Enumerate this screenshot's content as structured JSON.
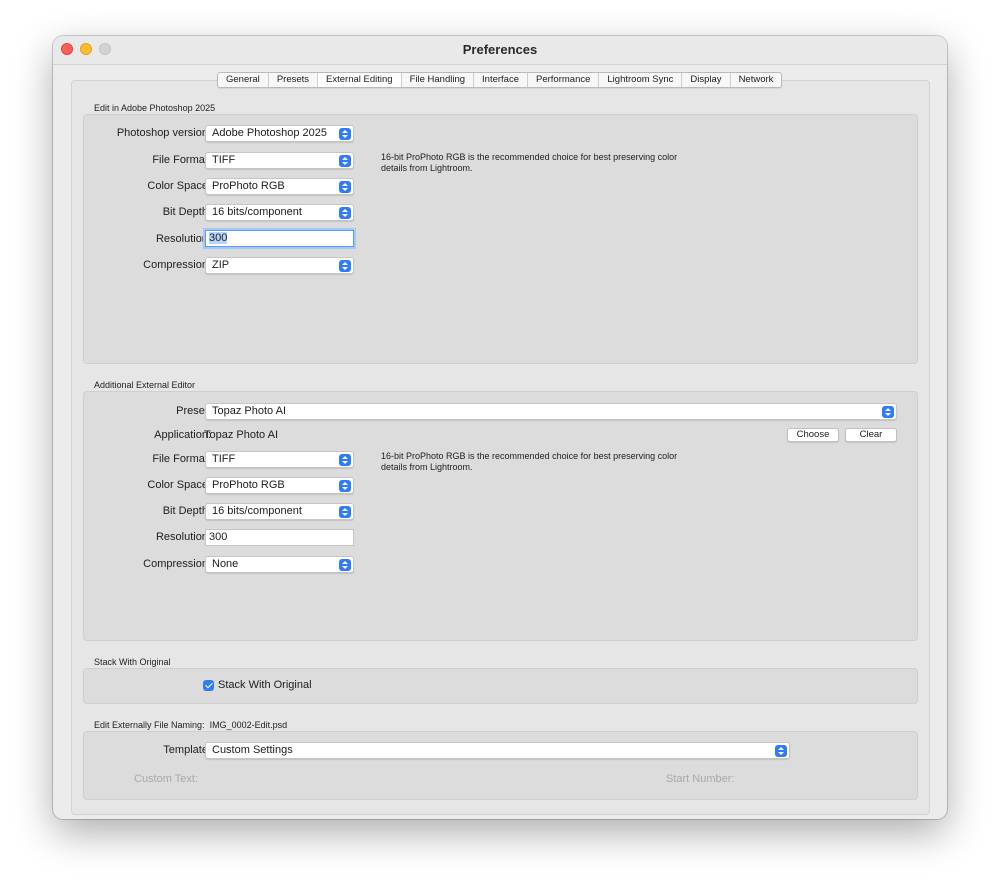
{
  "window": {
    "title": "Preferences"
  },
  "tabs": [
    "General",
    "Presets",
    "External Editing",
    "File Handling",
    "Interface",
    "Performance",
    "Lightroom Sync",
    "Display",
    "Network"
  ],
  "active_tab": "External Editing",
  "photoshop": {
    "section_title": "Edit in Adobe Photoshop 2025",
    "labels": {
      "version": "Photoshop version:",
      "file_format": "File Format:",
      "color_space": "Color Space:",
      "bit_depth": "Bit Depth:",
      "resolution": "Resolution:",
      "compression": "Compression:"
    },
    "values": {
      "version": "Adobe Photoshop 2025",
      "file_format": "TIFF",
      "color_space": "ProPhoto RGB",
      "bit_depth": "16 bits/component",
      "resolution": "300",
      "compression": "ZIP"
    },
    "note": "16-bit ProPhoto RGB is the recommended choice for best preserving color details from Lightroom."
  },
  "additional": {
    "section_title": "Additional External Editor",
    "labels": {
      "preset": "Preset:",
      "application": "Application:",
      "file_format": "File Format:",
      "color_space": "Color Space:",
      "bit_depth": "Bit Depth:",
      "resolution": "Resolution:",
      "compression": "Compression:"
    },
    "values": {
      "preset": "Topaz Photo AI",
      "application": "Topaz Photo AI",
      "file_format": "TIFF",
      "color_space": "ProPhoto RGB",
      "bit_depth": "16 bits/component",
      "resolution": "300",
      "compression": "None"
    },
    "choose_label": "Choose",
    "clear_label": "Clear",
    "note": "16-bit ProPhoto RGB is the recommended choice for best preserving color details from Lightroom."
  },
  "stack": {
    "section_title": "Stack With Original",
    "checkbox_label": "Stack With Original",
    "checked": true
  },
  "naming": {
    "section_title": "Edit Externally File Naming:",
    "example": "IMG_0002-Edit.psd",
    "template_label": "Template:",
    "template_value": "Custom Settings",
    "custom_text_label": "Custom Text:",
    "start_number_label": "Start Number:"
  },
  "colors": {
    "accent": "#2f7cf6",
    "close": "#fe5f57",
    "minimize": "#febc2e"
  }
}
